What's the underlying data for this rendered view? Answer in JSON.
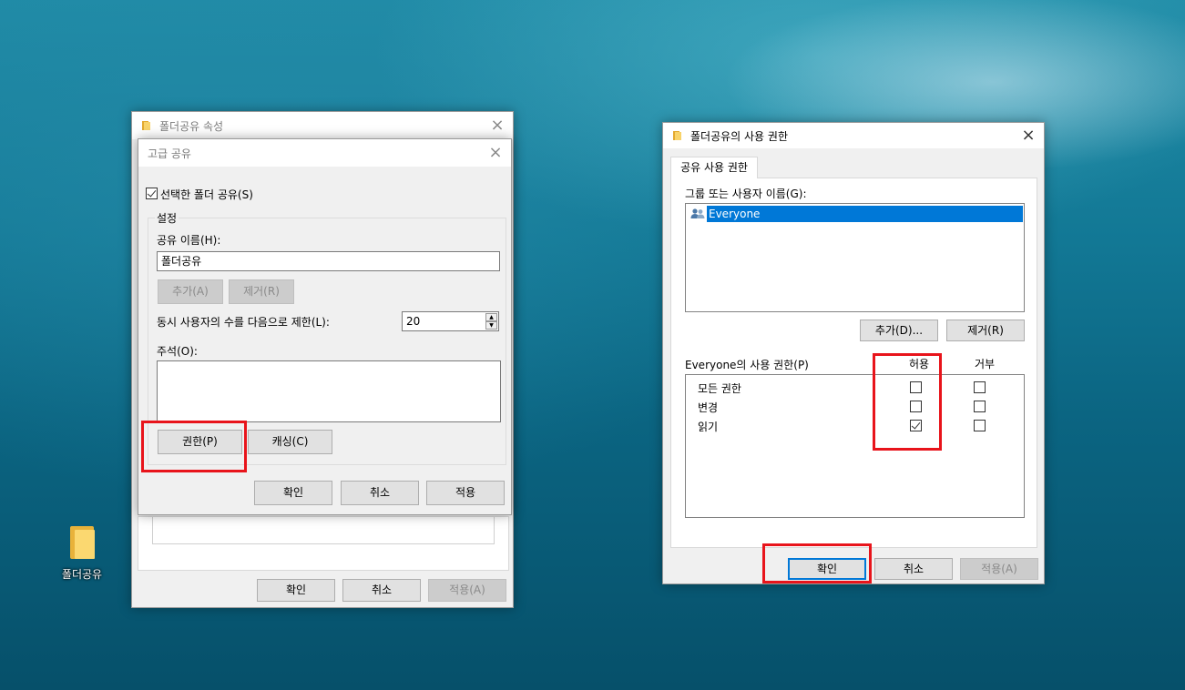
{
  "desktop": {
    "folder_label": "폴더공유"
  },
  "properties_window": {
    "title": "폴더공유 속성",
    "buttons": {
      "ok": "확인",
      "cancel": "취소",
      "apply": "적용(A)"
    }
  },
  "advanced_sharing": {
    "title": "고급 공유",
    "share_checkbox_label": "선택한 폴더 공유(S)",
    "share_checkbox_checked": true,
    "settings_group": "설정",
    "share_name_label": "공유 이름(H):",
    "share_name_value": "폴더공유",
    "add_button": "추가(A)",
    "remove_button": "제거(R)",
    "limit_label": "동시 사용자의 수를 다음으로 제한(L):",
    "limit_value": "20",
    "comment_label": "주석(O):",
    "permissions_button": "권한(P)",
    "caching_button": "캐싱(C)",
    "ok": "확인",
    "cancel": "취소",
    "apply": "적용"
  },
  "permissions_window": {
    "title": "폴더공유의 사용 권한",
    "tab": "공유 사용 권한",
    "group_label": "그룹 또는 사용자 이름(G):",
    "users": [
      "Everyone"
    ],
    "add_button": "추가(D)...",
    "remove_button": "제거(R)",
    "permissions_for_label": "Everyone의 사용 권한(P)",
    "allow_header": "허용",
    "deny_header": "거부",
    "permissions": [
      {
        "name": "모든 권한",
        "allow": false,
        "deny": false
      },
      {
        "name": "변경",
        "allow": false,
        "deny": false
      },
      {
        "name": "읽기",
        "allow": true,
        "deny": false
      }
    ],
    "ok": "확인",
    "cancel": "취소",
    "apply": "적용(A)"
  },
  "colors": {
    "highlight_red": "#e8141b",
    "selection_blue": "#0078d7"
  }
}
